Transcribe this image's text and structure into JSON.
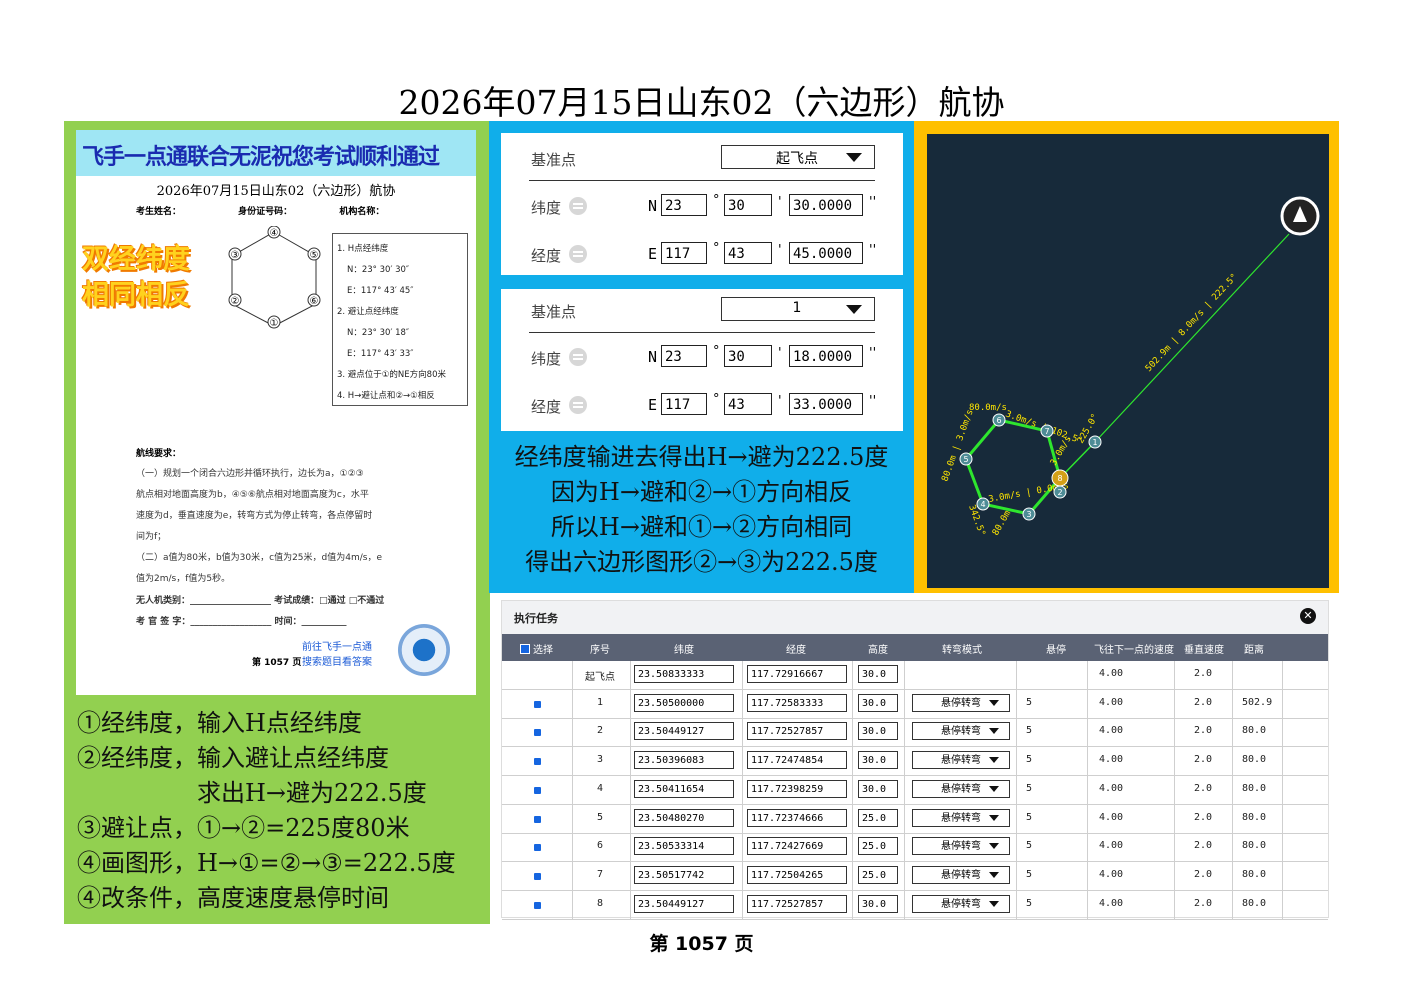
{
  "page_title": "2026年07月15日山东02（六边形）航协",
  "exam_sheet": {
    "banner": "飞手一点通联合无泥祝您考试顺利通过",
    "title": "2026年07月15日山东02（六边形）航协",
    "fields": [
      "考生姓名：",
      "身份证号码：",
      "机构名称："
    ],
    "stamp_line1": "双经纬度",
    "stamp_line2": "相同相反",
    "hex_labels": [
      "①",
      "②",
      "③",
      "④",
      "⑤",
      "⑥"
    ],
    "info": [
      "1. H点经纬度",
      "N：23° 30′ 30″",
      "E：117° 43′ 45″",
      "2. 避让点经纬度",
      "N：23° 30′ 18″",
      "E：117° 43′ 33″",
      "3. 避点位于①的NE方向80米",
      "4. H→避让点和②→①相反"
    ],
    "req_heading": "航线要求：",
    "req_lines": [
      "（一）规划一个闭合六边形并循环执行，边长为a，①②③",
      "航点相对地面高度为b，④⑤⑥航点相对地面高度为c，水平",
      "速度为d，垂直速度为e，转弯方式为停止转弯，各点停留时",
      "间为f；",
      "（二）a值为80米，b值为30米，c值为25米，d值为4m/s，e",
      "值为2m/s，f值为5秒。",
      "无人机类别：__________________  考试成绩：□通过  □不通过",
      "考 官 签 字：__________________ 时间：__________"
    ],
    "footer_page": "第 1057 页",
    "footer_link1": "前往飞手一点通",
    "footer_link2": "搜索题目看答案"
  },
  "left_notes": [
    "①经纬度，输入H点经纬度",
    "②经纬度，输入避让点经纬度",
    "　　　　　求出H→避为222.5度",
    "③避让点，①→②=225度80米",
    "④画图形，H→①=②→③=222.5度",
    "④改条件，高度速度悬停时间"
  ],
  "form1": {
    "base_label": "基准点",
    "base_value": "起飞点",
    "lat_label": "纬度",
    "lat_hemi": "N",
    "lat_deg": "23",
    "lat_min": "30",
    "lat_sec": "30.0000",
    "lon_label": "经度",
    "lon_hemi": "E",
    "lon_deg": "117",
    "lon_min": "43",
    "lon_sec": "45.0000"
  },
  "form2": {
    "base_label": "基准点",
    "base_value": "1",
    "lat_label": "纬度",
    "lat_hemi": "N",
    "lat_deg": "23",
    "lat_min": "30",
    "lat_sec": "18.0000",
    "lon_label": "经度",
    "lon_hemi": "E",
    "lon_deg": "117",
    "lon_min": "43",
    "lon_sec": "33.0000"
  },
  "symbols": {
    "deg": "°",
    "min": "'",
    "sec": "''"
  },
  "mid_text": [
    "经纬度输进去得出H→避为222.5度",
    "因为H→避和②→①方向相反",
    "所以H→避和①→②方向相同",
    "得出六边形图形②→③为222.5度"
  ],
  "map": {
    "long_leg_label": "502.9m | 8.0m/s | 222.5°",
    "short_leg_label": "225.0°",
    "leg_labels": [
      "80.0m/s",
      "3.0m/s | 102.5°",
      "80.0m | 3.0m/s",
      "3.0m/s | 0.0m/s",
      "342.5°",
      "80.0m",
      "3.0m/s"
    ],
    "waypoints": [
      "1",
      "2",
      "3",
      "4",
      "5",
      "6",
      "7",
      "8"
    ],
    "line_color": "#2ee62e",
    "label_color": "#ffe600"
  },
  "table": {
    "title": "执行任务",
    "headers": [
      "选择",
      "序号",
      "纬度",
      "经度",
      "高度",
      "转弯模式",
      "悬停",
      "飞往下一点的速度",
      "垂直速度",
      "距离"
    ],
    "rows": [
      {
        "seq": "起飞点",
        "lat": "23.50833333",
        "lon": "117.72916667",
        "alt": "30.0",
        "turn": "",
        "hover": "",
        "speed": "4.00",
        "vspeed": "2.0",
        "dist": ""
      },
      {
        "seq": "1",
        "lat": "23.50500000",
        "lon": "117.72583333",
        "alt": "30.0",
        "turn": "悬停转弯",
        "hover": "5",
        "speed": "4.00",
        "vspeed": "2.0",
        "dist": "502.9"
      },
      {
        "seq": "2",
        "lat": "23.50449127",
        "lon": "117.72527857",
        "alt": "30.0",
        "turn": "悬停转弯",
        "hover": "5",
        "speed": "4.00",
        "vspeed": "2.0",
        "dist": "80.0"
      },
      {
        "seq": "3",
        "lat": "23.50396083",
        "lon": "117.72474854",
        "alt": "30.0",
        "turn": "悬停转弯",
        "hover": "5",
        "speed": "4.00",
        "vspeed": "2.0",
        "dist": "80.0"
      },
      {
        "seq": "4",
        "lat": "23.50411654",
        "lon": "117.72398259",
        "alt": "30.0",
        "turn": "悬停转弯",
        "hover": "5",
        "speed": "4.00",
        "vspeed": "2.0",
        "dist": "80.0"
      },
      {
        "seq": "5",
        "lat": "23.50480270",
        "lon": "117.72374666",
        "alt": "25.0",
        "turn": "悬停转弯",
        "hover": "5",
        "speed": "4.00",
        "vspeed": "2.0",
        "dist": "80.0"
      },
      {
        "seq": "6",
        "lat": "23.50533314",
        "lon": "117.72427669",
        "alt": "25.0",
        "turn": "悬停转弯",
        "hover": "5",
        "speed": "4.00",
        "vspeed": "2.0",
        "dist": "80.0"
      },
      {
        "seq": "7",
        "lat": "23.50517742",
        "lon": "117.72504265",
        "alt": "25.0",
        "turn": "悬停转弯",
        "hover": "5",
        "speed": "4.00",
        "vspeed": "2.0",
        "dist": "80.0"
      },
      {
        "seq": "8",
        "lat": "23.50449127",
        "lon": "117.72527857",
        "alt": "30.0",
        "turn": "悬停转弯",
        "hover": "5",
        "speed": "4.00",
        "vspeed": "2.0",
        "dist": "80.0"
      }
    ]
  },
  "footer_page": "第 1057 页",
  "colors": {
    "left_panel": "#92d050",
    "mid_panel": "#10aeea",
    "map_frame": "#ffc000",
    "table_header": "#5a6274"
  }
}
